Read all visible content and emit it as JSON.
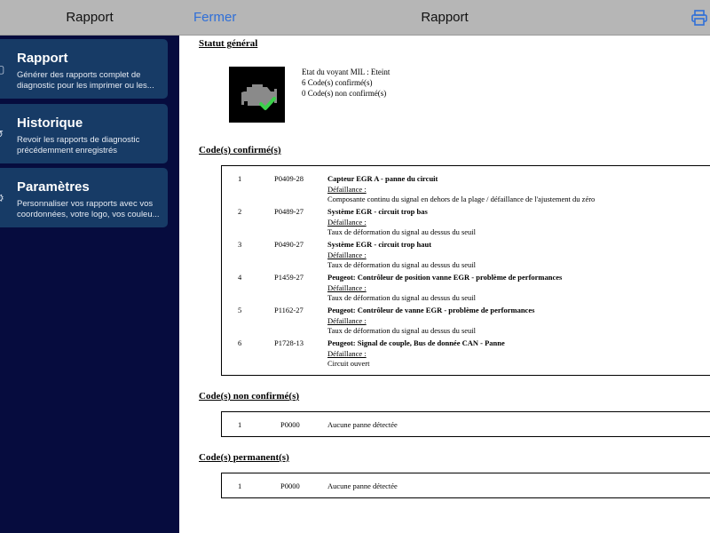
{
  "sidebar": {
    "title": "Rapport",
    "items": [
      {
        "label": "Rapport",
        "description": "Générer des rapports complet de diagnostic pour les imprimer ou les...",
        "icon": "document-icon"
      },
      {
        "label": "Historique",
        "description_line1": "Revoir les rapports de diagnostic",
        "description_line2": "précédemment enregistrés",
        "icon": "history-icon"
      },
      {
        "label": "Paramètres",
        "description": "Personnaliser vos rapports avec vos coordonnées, votre logo, vos couleu...",
        "icon": "settings-icon"
      }
    ]
  },
  "header": {
    "close_label": "Fermer",
    "title": "Rapport",
    "print_icon": "printer-icon",
    "accent_color": "#2f6fd8"
  },
  "report": {
    "general_status": {
      "title": "Statut général",
      "mil_status": "Etat du voyant MIL : Eteint",
      "confirmed_count": "6 Code(s) confirmé(s)",
      "unconfirmed_count": "0 Code(s) non confirmé(s)"
    },
    "confirmed": {
      "title": "Code(s) confirmé(s)",
      "rows": [
        {
          "num": "1",
          "code": "P0409-28",
          "title": "Capteur EGR A - panne du circuit",
          "fail_label": "Défaillance :",
          "detail": "Composante continu du signal en dehors de la plage / défaillance de l'ajustement du zéro"
        },
        {
          "num": "2",
          "code": "P0489-27",
          "title": "Système EGR - circuit trop bas",
          "fail_label": "Défaillance :",
          "detail": "Taux de déformation du signal au dessus du seuil"
        },
        {
          "num": "3",
          "code": "P0490-27",
          "title": "Système EGR - circuit trop haut",
          "fail_label": "Défaillance :",
          "detail": "Taux de déformation du signal au dessus du seuil"
        },
        {
          "num": "4",
          "code": "P1459-27",
          "title": "Peugeot: Contrôleur de position vanne EGR - problème de performances",
          "fail_label": "Défaillance :",
          "detail": "Taux de déformation du signal au dessus du seuil"
        },
        {
          "num": "5",
          "code": "P1162-27",
          "title": "Peugeot: Contrôleur de vanne EGR - problème de performances",
          "fail_label": "Défaillance :",
          "detail": "Taux de déformation du signal au dessus du seuil"
        },
        {
          "num": "6",
          "code": "P1728-13",
          "title": "Peugeot: Signal de couple, Bus de donnée CAN - Panne",
          "fail_label": "Défaillance :",
          "detail": "Circuit ouvert"
        }
      ]
    },
    "unconfirmed": {
      "title": "Code(s) non confirmé(s)",
      "rows": [
        {
          "num": "1",
          "code": "P0000",
          "text": "Aucune panne détectée"
        }
      ]
    },
    "permanent": {
      "title": "Code(s) permanent(s)",
      "rows": [
        {
          "num": "1",
          "code": "P0000",
          "text": "Aucune panne détectée"
        }
      ]
    }
  }
}
